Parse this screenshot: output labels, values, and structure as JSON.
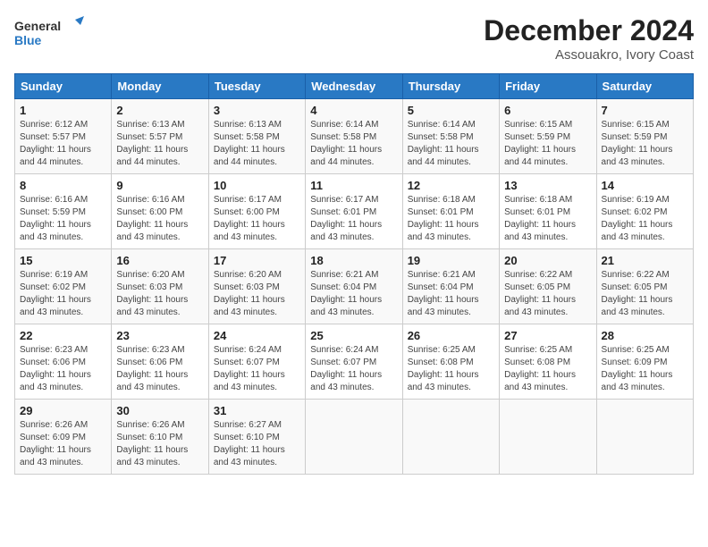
{
  "logo": {
    "line1": "General",
    "line2": "Blue"
  },
  "title": "December 2024",
  "subtitle": "Assouakro, Ivory Coast",
  "headers": [
    "Sunday",
    "Monday",
    "Tuesday",
    "Wednesday",
    "Thursday",
    "Friday",
    "Saturday"
  ],
  "weeks": [
    [
      {
        "day": "1",
        "sunrise": "6:12 AM",
        "sunset": "5:57 PM",
        "daylight": "11 hours and 44 minutes."
      },
      {
        "day": "2",
        "sunrise": "6:13 AM",
        "sunset": "5:57 PM",
        "daylight": "11 hours and 44 minutes."
      },
      {
        "day": "3",
        "sunrise": "6:13 AM",
        "sunset": "5:58 PM",
        "daylight": "11 hours and 44 minutes."
      },
      {
        "day": "4",
        "sunrise": "6:14 AM",
        "sunset": "5:58 PM",
        "daylight": "11 hours and 44 minutes."
      },
      {
        "day": "5",
        "sunrise": "6:14 AM",
        "sunset": "5:58 PM",
        "daylight": "11 hours and 44 minutes."
      },
      {
        "day": "6",
        "sunrise": "6:15 AM",
        "sunset": "5:59 PM",
        "daylight": "11 hours and 44 minutes."
      },
      {
        "day": "7",
        "sunrise": "6:15 AM",
        "sunset": "5:59 PM",
        "daylight": "11 hours and 43 minutes."
      }
    ],
    [
      {
        "day": "8",
        "sunrise": "6:16 AM",
        "sunset": "5:59 PM",
        "daylight": "11 hours and 43 minutes."
      },
      {
        "day": "9",
        "sunrise": "6:16 AM",
        "sunset": "6:00 PM",
        "daylight": "11 hours and 43 minutes."
      },
      {
        "day": "10",
        "sunrise": "6:17 AM",
        "sunset": "6:00 PM",
        "daylight": "11 hours and 43 minutes."
      },
      {
        "day": "11",
        "sunrise": "6:17 AM",
        "sunset": "6:01 PM",
        "daylight": "11 hours and 43 minutes."
      },
      {
        "day": "12",
        "sunrise": "6:18 AM",
        "sunset": "6:01 PM",
        "daylight": "11 hours and 43 minutes."
      },
      {
        "day": "13",
        "sunrise": "6:18 AM",
        "sunset": "6:01 PM",
        "daylight": "11 hours and 43 minutes."
      },
      {
        "day": "14",
        "sunrise": "6:19 AM",
        "sunset": "6:02 PM",
        "daylight": "11 hours and 43 minutes."
      }
    ],
    [
      {
        "day": "15",
        "sunrise": "6:19 AM",
        "sunset": "6:02 PM",
        "daylight": "11 hours and 43 minutes."
      },
      {
        "day": "16",
        "sunrise": "6:20 AM",
        "sunset": "6:03 PM",
        "daylight": "11 hours and 43 minutes."
      },
      {
        "day": "17",
        "sunrise": "6:20 AM",
        "sunset": "6:03 PM",
        "daylight": "11 hours and 43 minutes."
      },
      {
        "day": "18",
        "sunrise": "6:21 AM",
        "sunset": "6:04 PM",
        "daylight": "11 hours and 43 minutes."
      },
      {
        "day": "19",
        "sunrise": "6:21 AM",
        "sunset": "6:04 PM",
        "daylight": "11 hours and 43 minutes."
      },
      {
        "day": "20",
        "sunrise": "6:22 AM",
        "sunset": "6:05 PM",
        "daylight": "11 hours and 43 minutes."
      },
      {
        "day": "21",
        "sunrise": "6:22 AM",
        "sunset": "6:05 PM",
        "daylight": "11 hours and 43 minutes."
      }
    ],
    [
      {
        "day": "22",
        "sunrise": "6:23 AM",
        "sunset": "6:06 PM",
        "daylight": "11 hours and 43 minutes."
      },
      {
        "day": "23",
        "sunrise": "6:23 AM",
        "sunset": "6:06 PM",
        "daylight": "11 hours and 43 minutes."
      },
      {
        "day": "24",
        "sunrise": "6:24 AM",
        "sunset": "6:07 PM",
        "daylight": "11 hours and 43 minutes."
      },
      {
        "day": "25",
        "sunrise": "6:24 AM",
        "sunset": "6:07 PM",
        "daylight": "11 hours and 43 minutes."
      },
      {
        "day": "26",
        "sunrise": "6:25 AM",
        "sunset": "6:08 PM",
        "daylight": "11 hours and 43 minutes."
      },
      {
        "day": "27",
        "sunrise": "6:25 AM",
        "sunset": "6:08 PM",
        "daylight": "11 hours and 43 minutes."
      },
      {
        "day": "28",
        "sunrise": "6:25 AM",
        "sunset": "6:09 PM",
        "daylight": "11 hours and 43 minutes."
      }
    ],
    [
      {
        "day": "29",
        "sunrise": "6:26 AM",
        "sunset": "6:09 PM",
        "daylight": "11 hours and 43 minutes."
      },
      {
        "day": "30",
        "sunrise": "6:26 AM",
        "sunset": "6:10 PM",
        "daylight": "11 hours and 43 minutes."
      },
      {
        "day": "31",
        "sunrise": "6:27 AM",
        "sunset": "6:10 PM",
        "daylight": "11 hours and 43 minutes."
      },
      null,
      null,
      null,
      null
    ]
  ],
  "labels": {
    "sunrise": "Sunrise:",
    "sunset": "Sunset:",
    "daylight": "Daylight:"
  }
}
